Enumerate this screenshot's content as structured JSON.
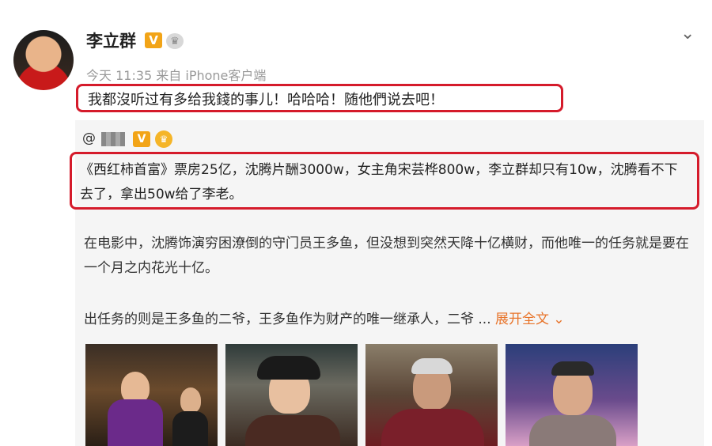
{
  "post": {
    "author": "李立群",
    "verified_badge": "V",
    "time": "今天 11:35",
    "source": "来自 iPhone客户端",
    "text": "我都沒听过有多给我錢的事儿！哈哈哈！随他們说去吧！"
  },
  "repost": {
    "user_prefix": "@",
    "verified_badge": "V",
    "highlight_text": "《西红柿首富》票房25亿，沈腾片酬3000w，女主角宋芸桦800w，李立群却只有10w，沈腾看不下去了，拿出50w给了李老。",
    "paragraph1": "在电影中，沈腾饰演穷困潦倒的守门员王多鱼，但没想到突然天降十亿横财，而他唯一的任务就是要在一个月之内花光十亿。",
    "paragraph2_text": "出任务的则是王多鱼的二爷，王多鱼作为财产的唯一继承人，二爷 ... ",
    "expand_label": "展开全文 ⌄"
  },
  "icons": {
    "chevron": "chevron-down-icon",
    "crown": "crown-icon"
  },
  "colors": {
    "highlight_border": "#d51b2b",
    "badge_v": "#f2a417",
    "expand": "#e8742a"
  }
}
